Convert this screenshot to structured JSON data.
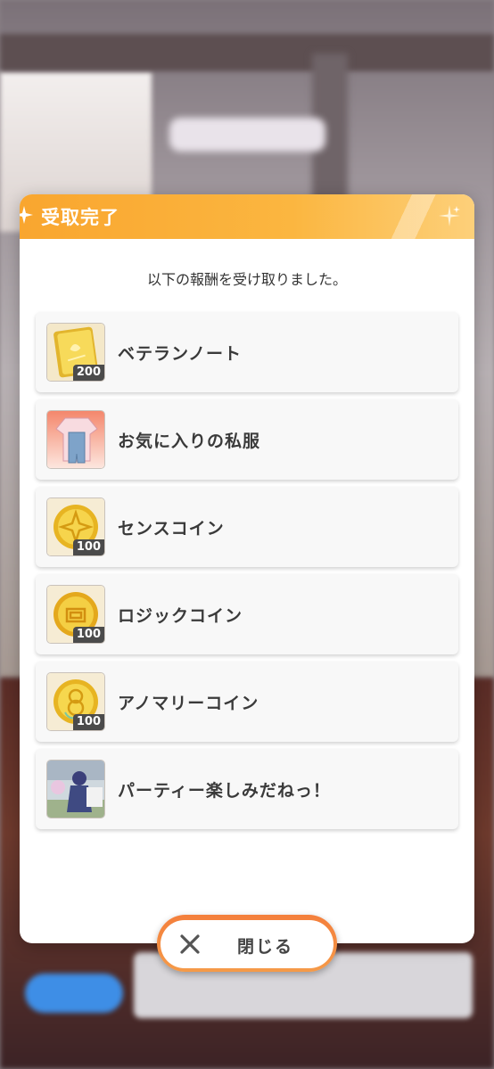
{
  "dialog": {
    "title": "受取完了",
    "message": "以下の報酬を受け取りました。",
    "accent_color": "#f9a62f"
  },
  "rewards": [
    {
      "name": "ベテランノート",
      "quantity": "200",
      "icon": "veteran-note-icon"
    },
    {
      "name": "お気に入りの私服",
      "quantity": "",
      "icon": "outfit-icon"
    },
    {
      "name": "センスコイン",
      "quantity": "100",
      "icon": "sense-coin-icon"
    },
    {
      "name": "ロジックコイン",
      "quantity": "100",
      "icon": "logic-coin-icon"
    },
    {
      "name": "アノマリーコイン",
      "quantity": "100",
      "icon": "anomaly-coin-icon"
    },
    {
      "name": "パーティー楽しみだねっ！",
      "quantity": "",
      "icon": "scene-card-icon"
    }
  ],
  "close_button": {
    "label": "閉じる",
    "icon": "close-icon"
  }
}
